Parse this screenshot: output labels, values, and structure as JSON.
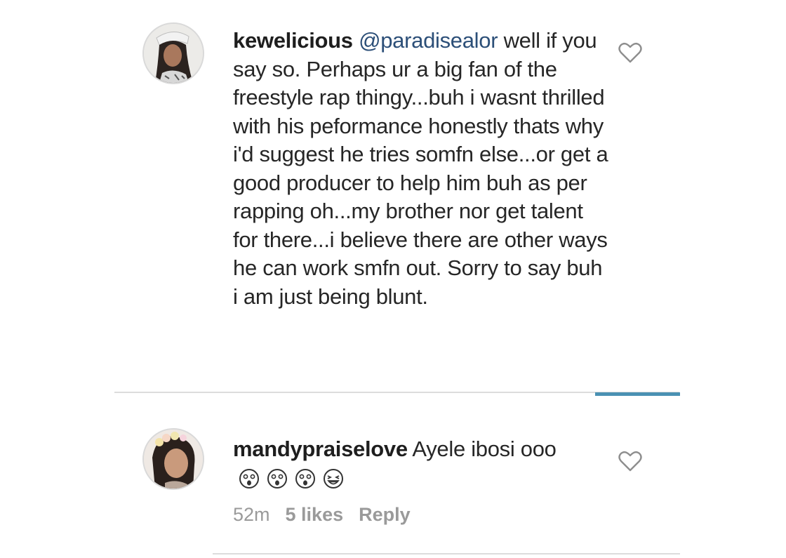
{
  "comments": [
    {
      "username": "kewelicious",
      "mention": "@paradisealor",
      "text": " well if you say so. Perhaps ur a big fan of the freestyle rap thingy...buh i wasnt thrilled with his peformance honestly thats why i'd suggest he tries somfn else...or get a good producer to help him buh as per rapping oh...my brother nor get talent for there...i believe there are other ways he can work smfn out. Sorry to say buh i am just being blunt.",
      "avatar_icon": "user-avatar-icon",
      "like_icon": "heart-outline-icon"
    },
    {
      "username": "mandypraiselove",
      "text": " Ayele ibosi ooo",
      "emojis": [
        "astonished-face-icon",
        "astonished-face-icon",
        "astonished-face-icon",
        "grinning-squint-face-icon"
      ],
      "time": "52m",
      "likes": "5 likes",
      "reply": "Reply",
      "avatar_icon": "user-avatar-icon",
      "like_icon": "heart-outline-icon"
    }
  ],
  "colors": {
    "mention": "#2c4f78",
    "active_bar": "#4a91b3",
    "divider": "#dcdcdc",
    "meta": "#9a9a9a"
  }
}
